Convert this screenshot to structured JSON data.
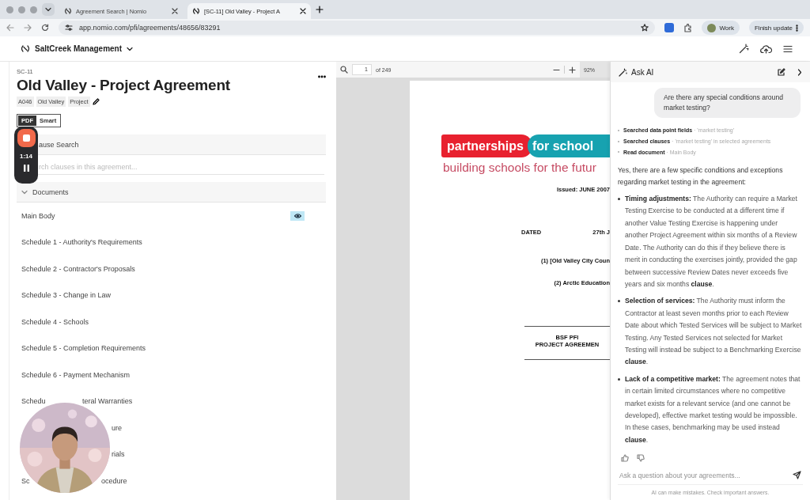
{
  "browser": {
    "tabs": [
      {
        "title": "Agreement Search | Nomio",
        "selected": false
      },
      {
        "title": "[SC-11] Old Valley - Project A",
        "selected": true
      }
    ],
    "url": "app.nomio.com/pfi/agreements/48656/83291",
    "profile": "Work",
    "update_button": "Finish update"
  },
  "app": {
    "organization": "SaltCreek Management"
  },
  "agreement": {
    "code": "SC-11",
    "title": "Old Valley - Project Agreement",
    "tags": [
      "A046",
      "Old Valley",
      "Project"
    ]
  },
  "view_toggle": [
    {
      "label": "PDF",
      "selected": true
    },
    {
      "label": "Smart",
      "selected": false
    }
  ],
  "recorder": {
    "time": "1:14"
  },
  "clause_search": {
    "title": "ause Search",
    "placeholder": "rch clauses in this agreement..."
  },
  "documents": {
    "title": "Documents",
    "expanded": true,
    "items": [
      {
        "kind": "full",
        "parts": [
          "Main Body"
        ],
        "viewing": true
      },
      {
        "kind": "full",
        "parts": [
          "Schedule 1 - Authority's Requirements"
        ],
        "viewing": false
      },
      {
        "kind": "full",
        "parts": [
          "Schedule 2 - Contractor's Proposals"
        ],
        "viewing": false
      },
      {
        "kind": "full",
        "parts": [
          "Schedule 3 - Change in Law"
        ],
        "viewing": false
      },
      {
        "kind": "full",
        "parts": [
          "Schedule 4 - Schools"
        ],
        "viewing": false
      },
      {
        "kind": "full",
        "parts": [
          "Schedule 5 - Completion Requirements"
        ],
        "viewing": false
      },
      {
        "kind": "full",
        "parts": [
          "Schedule 6 - Payment Mechanism"
        ],
        "viewing": false
      },
      {
        "kind": "gap-top",
        "parts": [
          "Schedu",
          "teral Warranties"
        ],
        "viewing": false
      },
      {
        "kind": "tail",
        "parts": [
          "ure"
        ],
        "viewing": false
      },
      {
        "kind": "tail",
        "parts": [
          "rials"
        ],
        "viewing": false
      },
      {
        "kind": "gap-bottom",
        "parts": [
          "Sc",
          "ocedure"
        ],
        "viewing": false
      }
    ]
  },
  "pdf": {
    "page": "1",
    "page_count": "of 249",
    "zoom": "92%",
    "logo": [
      "partnerships",
      "for school"
    ],
    "tagline": "building schools for the futur",
    "lines": [
      {
        "kind": "right",
        "texts": [
          "Issued: JUNE 2007"
        ]
      },
      {
        "kind": "pair",
        "texts": [
          "DATED",
          "27th J"
        ]
      },
      {
        "kind": "right",
        "texts": [
          "(1) [Old Valley City Coun"
        ]
      },
      {
        "kind": "right",
        "texts": [
          "(2) Arctic Education"
        ]
      },
      {
        "kind": "block",
        "texts": [
          "BSF PFI",
          "PROJECT AGREEMEN"
        ]
      }
    ]
  },
  "ai_panel": {
    "title": "Ask AI",
    "question": "Are there any special conditions around market testing?",
    "steps": [
      {
        "action": "Searched data point fields",
        "detail": "· 'market testing'"
      },
      {
        "action": "Searched clauses",
        "detail": "· 'market testing' in selected agreements"
      },
      {
        "action": "Read document",
        "detail": "· Main Body"
      }
    ],
    "answer_intro": "Yes, there are a few specific conditions and exceptions regarding market testing in the agreement:",
    "bullets": [
      "**Timing adjustments:** The Authority can require a Market Testing Exercise to be conducted at a different time if another Value Testing Exercise is happening under another Project Agreement within six months of a Review Date. The Authority can do this if they believe there is merit in conducting the exercises jointly, provided the gap between successive Review Dates never exceeds five years and six months **clause**.",
      "**Selection of services:** The Authority must inform the Contractor at least seven months prior to each Review Date about which Tested Services will be subject to Market Testing. Any Tested Services not selected for Market Testing will instead be subject to a Benchmarking Exercise **clause**.",
      "**Lack of a competitive market:** The agreement notes that in certain limited circumstances where no competitive market exists for a relevant service (and one cannot be developed), effective market testing would be impossible. In these cases, benchmarking may be used instead **clause**."
    ],
    "input_placeholder": "Ask a question about your agreements...",
    "disclaimer": "AI can make mistakes. Check important answers."
  }
}
